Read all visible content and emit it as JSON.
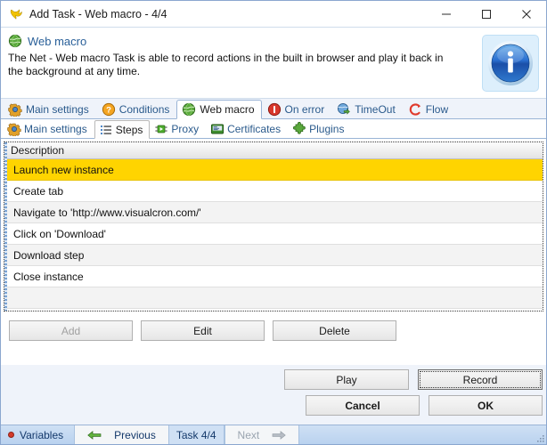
{
  "window": {
    "title": "Add Task - Web macro - 4/4",
    "title_icon": "visualcron-logo-icon",
    "controls": {
      "minimize": "minimize-icon",
      "maximize": "maximize-icon",
      "close": "close-icon"
    }
  },
  "header": {
    "icon": "globe-icon",
    "title": "Web macro",
    "description": "The Net - Web macro Task is able to record actions in the built in browser and play it back in the background at any time.",
    "info_icon": "info-icon"
  },
  "tabs_primary": [
    {
      "label": "Main settings",
      "icon": "gear-icon",
      "selected": false
    },
    {
      "label": "Conditions",
      "icon": "question-mark-icon",
      "selected": false
    },
    {
      "label": "Web macro",
      "icon": "globe-icon",
      "selected": true
    },
    {
      "label": "On error",
      "icon": "error-circle-icon",
      "selected": false
    },
    {
      "label": "TimeOut",
      "icon": "timeout-globe-icon",
      "selected": false
    },
    {
      "label": "Flow",
      "icon": "flow-arrow-icon",
      "selected": false
    }
  ],
  "tabs_secondary": [
    {
      "label": "Main settings",
      "icon": "gear-icon",
      "selected": false
    },
    {
      "label": "Steps",
      "icon": "list-steps-icon",
      "selected": true
    },
    {
      "label": "Proxy",
      "icon": "proxy-plug-icon",
      "selected": false
    },
    {
      "label": "Certificates",
      "icon": "certificate-icon",
      "selected": false
    },
    {
      "label": "Plugins",
      "icon": "puzzle-piece-icon",
      "selected": false
    }
  ],
  "steps_grid": {
    "columns": [
      "Description"
    ],
    "rows": [
      {
        "description": "Launch new instance",
        "selected": true
      },
      {
        "description": "Create tab",
        "selected": false
      },
      {
        "description": "Navigate to 'http://www.visualcron.com/'",
        "selected": false
      },
      {
        "description": "Click on 'Download'",
        "selected": false
      },
      {
        "description": "Download step",
        "selected": false
      },
      {
        "description": "Close instance",
        "selected": false
      }
    ],
    "selected_row_color": "#ffd400"
  },
  "crud_buttons": {
    "add": "Add",
    "add_enabled": false,
    "edit": "Edit",
    "delete": "Delete"
  },
  "macro_buttons": {
    "play": "Play",
    "record": "Record",
    "record_focused": true
  },
  "dialog_buttons": {
    "cancel": "Cancel",
    "ok": "OK"
  },
  "statusbar": {
    "variables": "Variables",
    "variables_icon": "red-dot-icon",
    "previous": "Previous",
    "previous_icon": "arrow-left-green-icon",
    "task_counter": "Task 4/4",
    "next": "Next",
    "next_icon": "arrow-right-gray-icon",
    "next_enabled": false,
    "resize_grip": "resize-grip-icon"
  },
  "colors": {
    "accent_blue": "#2a6099",
    "window_chrome": "#eff3fa",
    "selection_gold": "#ffd400",
    "status_bar": "#b9d2ef"
  }
}
